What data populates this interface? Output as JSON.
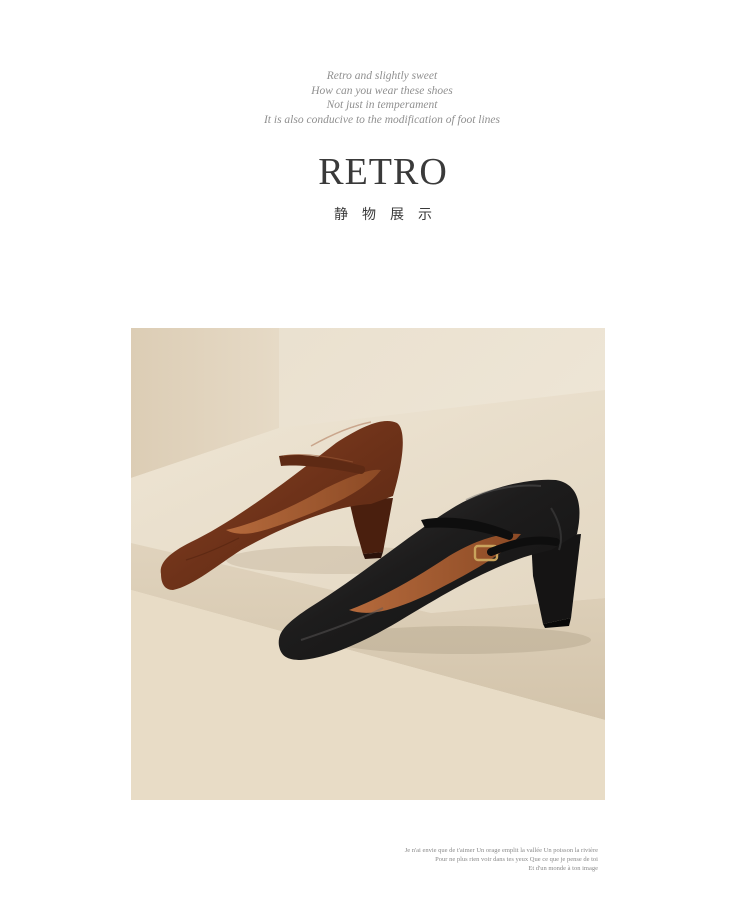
{
  "intro": {
    "lines": [
      "Retro and slightly sweet",
      "How can you wear these shoes",
      "Not just in temperament",
      "It is also conducive to the modification of foot lines"
    ]
  },
  "heading": {
    "title": "RETRO",
    "subtitle": "静物展示"
  },
  "photo": {
    "subject": "two square-toe Mary Jane block-heel pumps, brown and black leather, on a beige step",
    "colors": {
      "wall": "#ece3d3",
      "step_top": "#e7dcc8",
      "step_front": "#d9cbb4",
      "brown_shoe": "#7a3a20",
      "black_shoe": "#1c1b1b"
    }
  },
  "footnote": {
    "lines": [
      "Je n'ai envie que de t'aimer Un orage emplit la vallée Un poisson la rivière",
      "Pour ne plus rien voir dans tes yeux Que ce que je pense de toi",
      "Et d'un monde à ton image"
    ]
  }
}
